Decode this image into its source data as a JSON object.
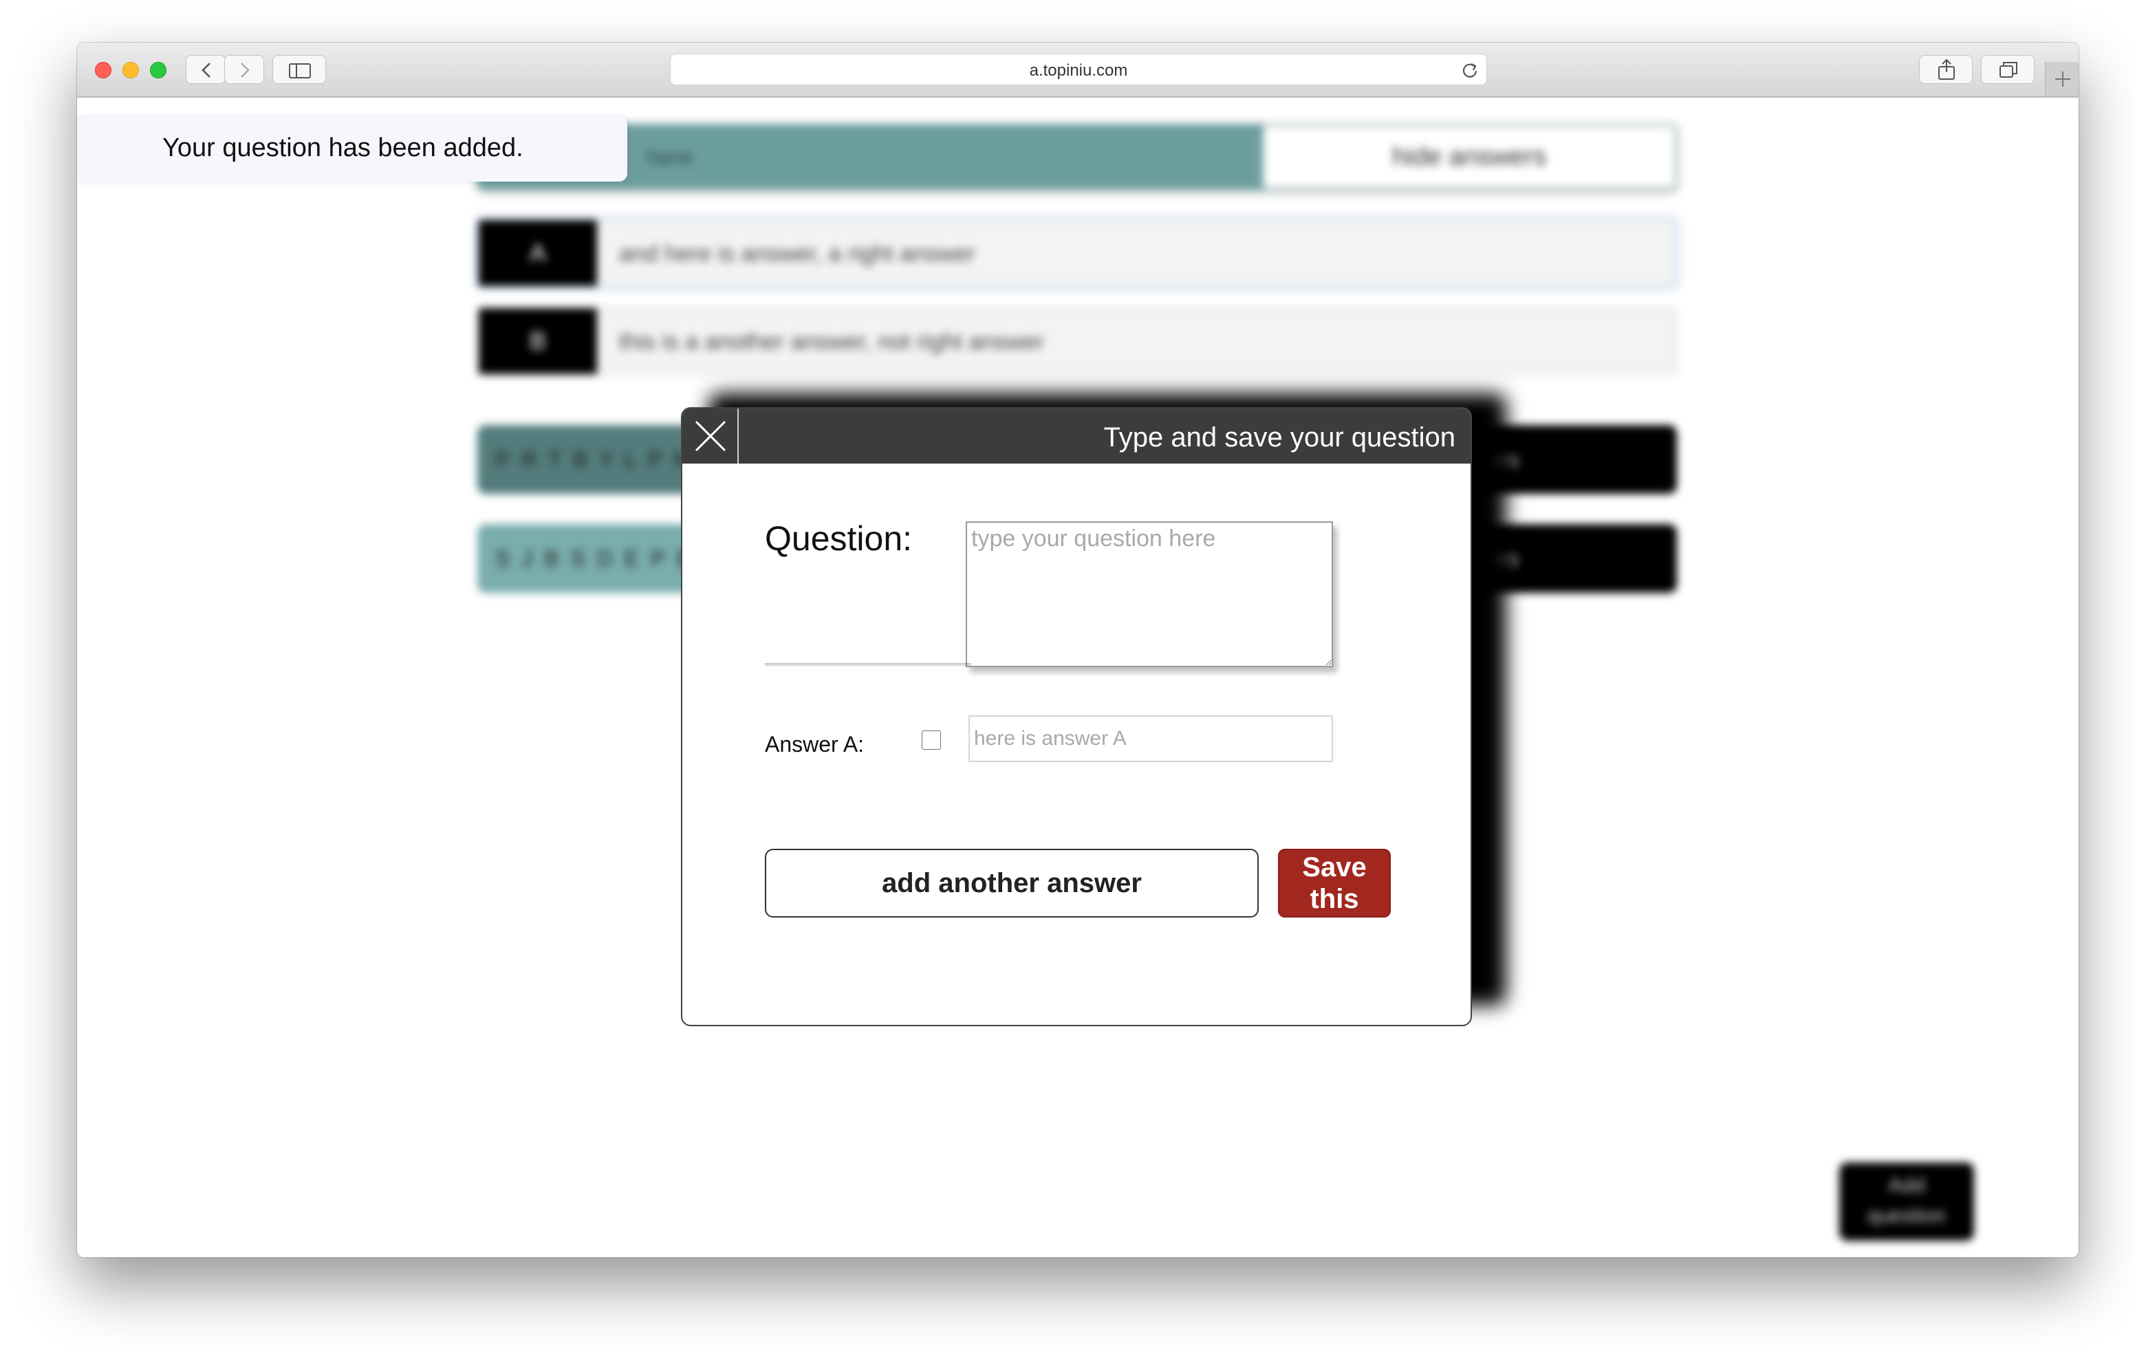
{
  "browser": {
    "url": "a.topiniu.com"
  },
  "background": {
    "header_left": "here",
    "hide_answers": "hide answers",
    "answers": [
      {
        "letter": "A",
        "text": "and here is answer, a right answer"
      },
      {
        "letter": "B",
        "text": "this is a another answer, not right answer"
      }
    ],
    "rows": [
      {
        "left": "P R T B Y L P M",
        "right": "ers"
      },
      {
        "left": "S J B S D E P B T",
        "right": "ers"
      }
    ],
    "add_question": [
      "Add",
      "question"
    ]
  },
  "toast": {
    "message": "Your question has been added."
  },
  "modal": {
    "title": "Type and save your question",
    "question_label": "Question:",
    "question_placeholder": "type your question here",
    "answer_label": "Answer A:",
    "answer_placeholder": "here is answer A",
    "add_answer_label": "add another answer",
    "save_label": [
      "Save",
      "this"
    ]
  },
  "colors": {
    "modal_header": "#3c3c3c",
    "save_button": "#a1271f",
    "teal": "#6d9e9e",
    "toast_bg": "#f6f6fc"
  },
  "icons": [
    "close-icon",
    "chevron-left-icon",
    "chevron-right-icon",
    "sidebar-icon",
    "share-icon",
    "tabs-icon",
    "reload-icon",
    "plus-icon"
  ]
}
